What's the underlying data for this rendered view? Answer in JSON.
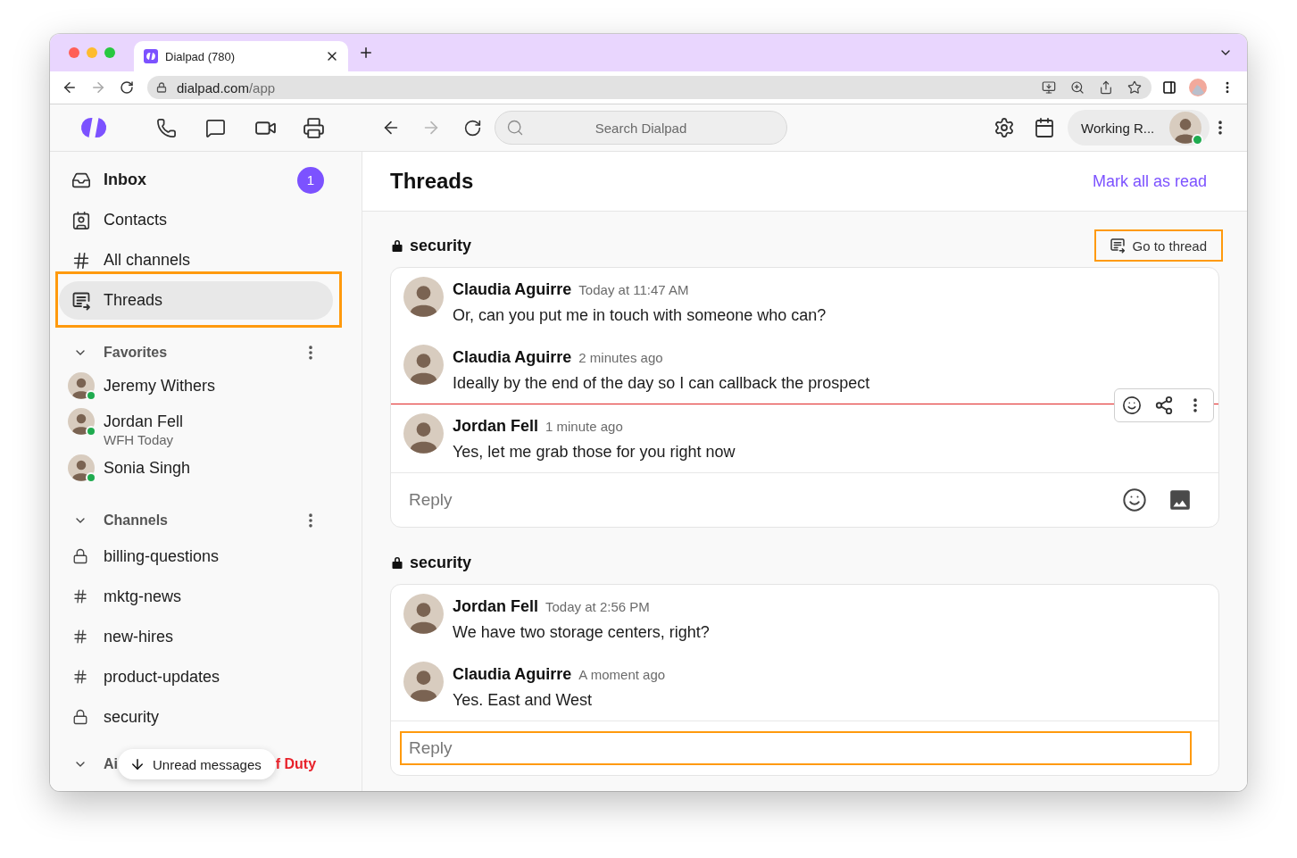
{
  "browser": {
    "tab": {
      "title": "Dialpad (780)"
    },
    "can_go_forward": false,
    "url": {
      "host": "dialpad.com",
      "path": "/app"
    }
  },
  "toolbar": {
    "can_go_forward": false,
    "search": {
      "placeholder": "Search Dialpad"
    },
    "status": {
      "label": "Working R...",
      "online": true
    }
  },
  "sidebar": {
    "nav": [
      {
        "kind": "inbox",
        "label": "Inbox",
        "badge": "1",
        "unread": true,
        "selected": false,
        "highlighted": false
      },
      {
        "kind": "contacts",
        "label": "Contacts",
        "unread": false,
        "selected": false,
        "highlighted": false
      },
      {
        "kind": "channels",
        "label": "All channels",
        "unread": false,
        "selected": false,
        "highlighted": false
      },
      {
        "kind": "threads",
        "label": "Threads",
        "unread": false,
        "selected": true,
        "highlighted": true
      }
    ],
    "favorites": {
      "label": "Favorites",
      "expanded": true,
      "contacts": [
        {
          "name": "Jeremy Withers",
          "online": true
        },
        {
          "name": "Jordan Fell",
          "status": "WFH Today",
          "online": true
        },
        {
          "name": "Sonia Singh",
          "online": true
        }
      ]
    },
    "channels": {
      "label": "Channels",
      "expanded": true,
      "items": [
        {
          "name": "billing-questions",
          "private": true
        },
        {
          "name": "mktg-news",
          "private": false
        },
        {
          "name": "new-hires",
          "private": false
        },
        {
          "name": "product-updates",
          "private": false
        },
        {
          "name": "security",
          "private": true
        }
      ]
    },
    "section_3": {
      "label": "Ai",
      "status": "f Duty",
      "expanded": true
    },
    "unread_jump": {
      "label": "Unread messages"
    }
  },
  "main": {
    "title": "Threads",
    "mark_all_read": "Mark all as read",
    "threads": [
      {
        "channel": "security",
        "private": true,
        "go_to": {
          "label": "Go to thread",
          "highlighted": true
        },
        "messages": [
          {
            "author": "Claudia Aguirre",
            "time": "Today at 11:47 AM",
            "text": "Or, can you put me in touch with someone who can?",
            "unread_divider": false,
            "hovered": false
          },
          {
            "author": "Claudia Aguirre",
            "time": "2 minutes ago",
            "text": "Ideally by the end of the day so I can callback the prospect",
            "unread_divider": false,
            "hovered": true
          },
          {
            "author": "Jordan Fell",
            "time": "1 minute ago",
            "text": "Yes, let me grab those for you right now",
            "unread_divider": true,
            "hovered": false
          }
        ],
        "reply": {
          "placeholder": "Reply",
          "highlighted": false,
          "tools": true
        }
      },
      {
        "channel": "security",
        "private": true,
        "messages": [
          {
            "author": "Jordan Fell",
            "time": "Today at 2:56 PM",
            "text": "We have two storage centers, right?",
            "unread_divider": false,
            "hovered": false
          },
          {
            "author": "Claudia Aguirre",
            "time": "A moment ago",
            "text": "Yes. East and West",
            "unread_divider": false,
            "hovered": false
          }
        ],
        "reply": {
          "placeholder": "Reply",
          "highlighted": true,
          "tools": false
        }
      }
    ]
  }
}
